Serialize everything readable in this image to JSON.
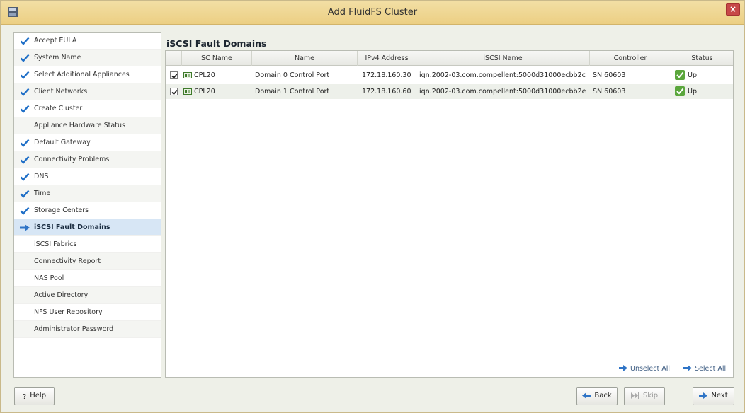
{
  "window": {
    "title": "Add FluidFS Cluster",
    "close_glyph": "×"
  },
  "sidebar": {
    "items": [
      {
        "label": "Accept EULA",
        "state": "done"
      },
      {
        "label": "System Name",
        "state": "done"
      },
      {
        "label": "Select Additional Appliances",
        "state": "done"
      },
      {
        "label": "Client Networks",
        "state": "done"
      },
      {
        "label": "Create Cluster",
        "state": "done"
      },
      {
        "label": "Appliance Hardware Status",
        "state": "pending"
      },
      {
        "label": "Default Gateway",
        "state": "done"
      },
      {
        "label": "Connectivity Problems",
        "state": "done"
      },
      {
        "label": "DNS",
        "state": "done"
      },
      {
        "label": "Time",
        "state": "done"
      },
      {
        "label": "Storage Centers",
        "state": "done"
      },
      {
        "label": "iSCSI Fault Domains",
        "state": "current"
      },
      {
        "label": "iSCSI Fabrics",
        "state": "pending"
      },
      {
        "label": "Connectivity Report",
        "state": "pending"
      },
      {
        "label": "NAS Pool",
        "state": "pending"
      },
      {
        "label": "Active Directory",
        "state": "pending"
      },
      {
        "label": "NFS User Repository",
        "state": "pending"
      },
      {
        "label": "Administrator Password",
        "state": "pending"
      }
    ]
  },
  "main": {
    "title": "iSCSI Fault Domains",
    "columns": [
      "SC Name",
      "Name",
      "IPv4 Address",
      "iSCSI Name",
      "Controller",
      "Status"
    ],
    "rows": [
      {
        "checked": true,
        "sc_name": "CPL20",
        "name": "Domain 0 Control Port",
        "ipv4": "172.18.160.30",
        "iscsi_name": "iqn.2002-03.com.compellent:5000d31000ecbb2c",
        "controller": "SN 60603",
        "status": "Up"
      },
      {
        "checked": true,
        "sc_name": "CPL20",
        "name": "Domain 1 Control Port",
        "ipv4": "172.18.160.60",
        "iscsi_name": "iqn.2002-03.com.compellent:5000d31000ecbb2e",
        "controller": "SN 60603",
        "status": "Up"
      }
    ],
    "unselect_all": "Unselect All",
    "select_all": "Select All"
  },
  "footer": {
    "help": "Help",
    "help_glyph": "?",
    "back": "Back",
    "skip": "Skip",
    "next": "Next"
  },
  "colors": {
    "accent_check": "#1f6fc7",
    "status_up": "#5aa63c",
    "title_bar": "#eccf83"
  }
}
